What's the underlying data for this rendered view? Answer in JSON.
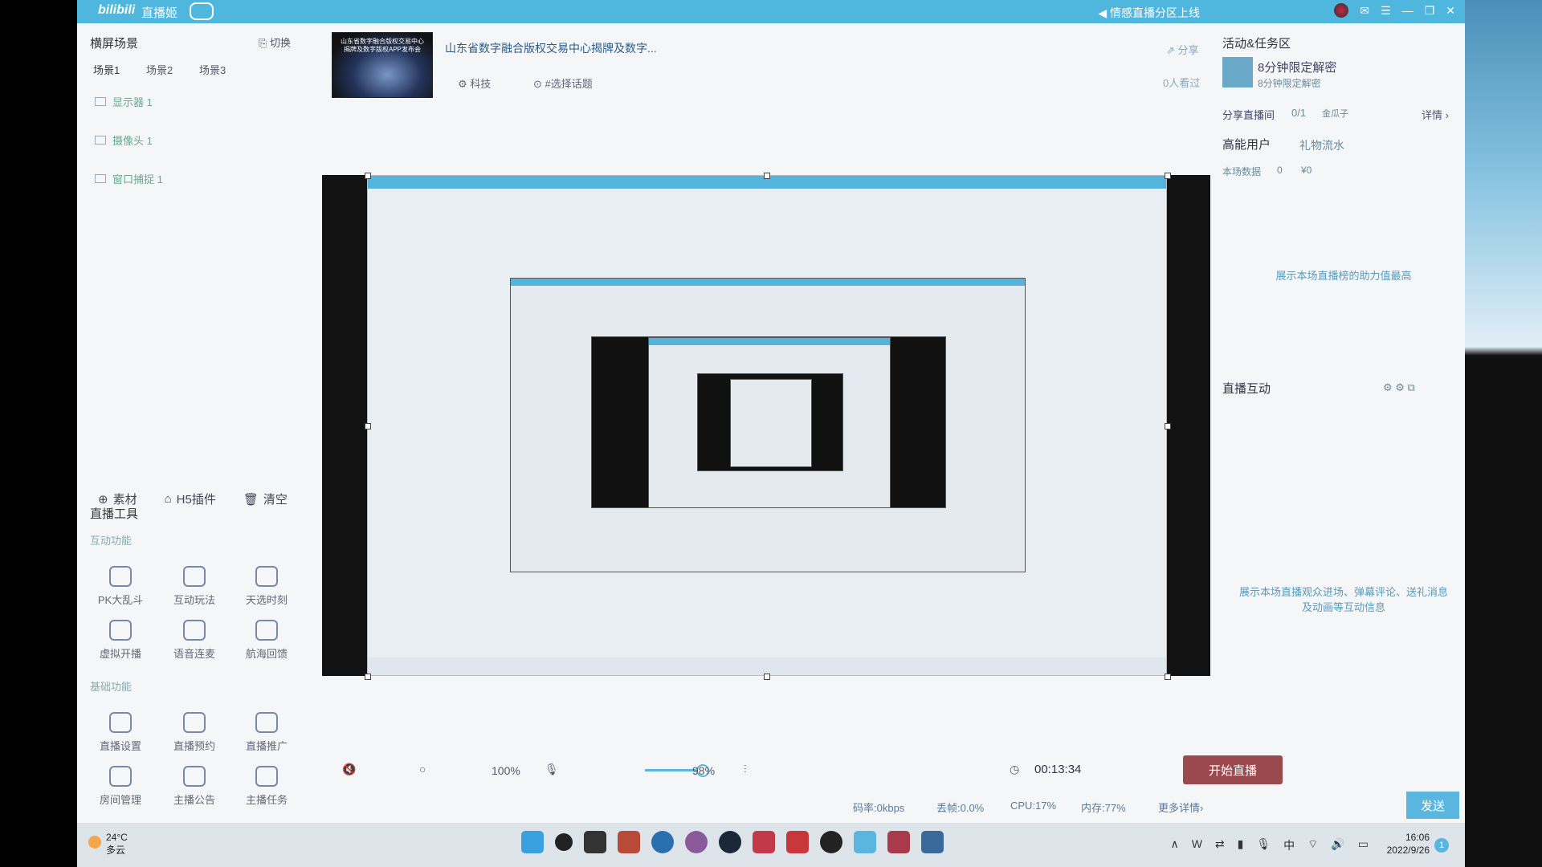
{
  "titlebar": {
    "logo": "bilibili",
    "title": "直播姬",
    "notice": "情感直播分区上线"
  },
  "left": {
    "scene_heading": "横屏场景",
    "switch_label": "切换",
    "scenes": [
      "场景1",
      "场景2",
      "场景3"
    ],
    "sources": [
      "显示器 1",
      "摄像头 1",
      "窗口捕捉 1"
    ],
    "tools": {
      "material": "素材",
      "h5": "H5插件",
      "clear": "清空"
    },
    "live_tools_heading": "直播工具",
    "interactive_heading": "互动功能",
    "interactive": [
      "PK大乱斗",
      "互动玩法",
      "天选时刻",
      "虚拟开播",
      "语音连麦",
      "航海回馈"
    ],
    "basic_heading": "基础功能",
    "basic": [
      "直播设置",
      "直播预约",
      "直播推广",
      "房间管理",
      "主播公告",
      "主播任务"
    ]
  },
  "stream": {
    "thumb_text": "山东省数字融合版权交易中心揭牌及数字版权APP发布会",
    "title": "山东省数字融合版权交易中心揭牌及数字...",
    "category": "科技",
    "topic": "#选择话题",
    "share": "分享",
    "viewers": "0人看过"
  },
  "right": {
    "activity_heading": "活动&任务区",
    "activity_item": "8分钟限定解密",
    "activity_sub": "8分钟限定解密",
    "share_room": "分享直播间",
    "share_count": "0/1",
    "share_reward": "金瓜子",
    "details": "详情",
    "high_energy": "高能用户",
    "gift_flow": "礼物流水",
    "stats_label": "本场数据",
    "stats_count": "0",
    "stats_money": "¥0",
    "help_msg": "展示本场直播榜的助力值最高",
    "interact_heading": "直播互动",
    "interact_msg": "展示本场直播观众进场、弹幕评论、送礼消息及动画等互动信息",
    "send": "发送"
  },
  "controls": {
    "speaker_level": "100%",
    "mic_level": "98%",
    "timer": "00:13:34",
    "start": "开始直播",
    "bitrate": "码率:0kbps",
    "drop": "丢帧:0.0%",
    "cpu": "CPU:17%",
    "mem": "内存:77%",
    "more": "更多详情"
  },
  "taskbar": {
    "temp": "24°C",
    "weather": "多云",
    "ime": "中",
    "time": "16:06",
    "date": "2022/9/26",
    "notifications": "1"
  }
}
